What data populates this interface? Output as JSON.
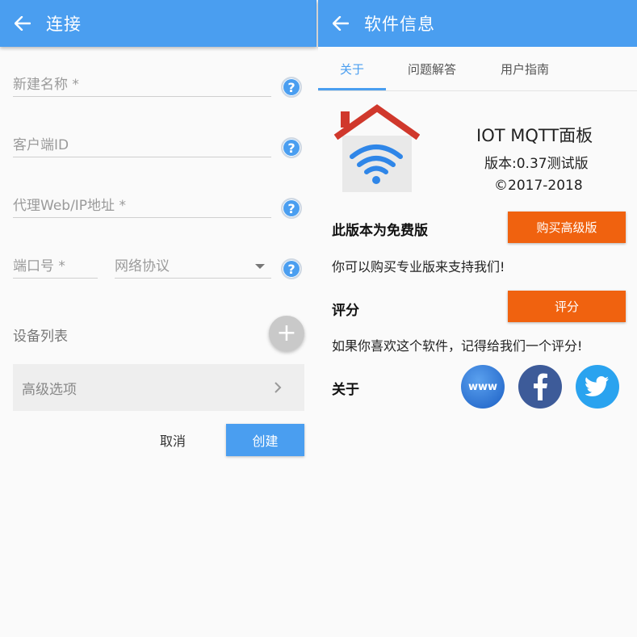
{
  "left": {
    "title": "连接",
    "fields": {
      "name": "新建名称 *",
      "client_id": "客户端ID",
      "broker": "代理Web/IP地址 *",
      "port": "端口号 *",
      "protocol": "网络协议"
    },
    "help_glyph": "?",
    "device_list": "设备列表",
    "add_glyph": "+",
    "advanced": "高级选项",
    "cancel": "取消",
    "create": "创建"
  },
  "right": {
    "title": "软件信息",
    "tabs": [
      "关于",
      "问题解答",
      "用户指南"
    ],
    "app_name": "IOT MQTT面板",
    "version": "版本:0.37测试版",
    "copyright": "©2017-2018",
    "free_title": "此版本为免费版",
    "buy_button": "购买高级版",
    "support_text": "你可以购买专业版来支持我们!",
    "rate_title": "评分",
    "rate_button": "评分",
    "rate_text": "如果你喜欢这个软件，记得给我们一个评分!",
    "about_title": "关于",
    "www_label": "www"
  },
  "colors": {
    "primary": "#4a9ef0",
    "accent": "#f0620f",
    "facebook": "#3d5b99",
    "twitter": "#2aa3ef"
  },
  "icons": [
    "back-arrow-icon",
    "help-icon",
    "add-icon",
    "chevron-right-icon",
    "dropdown-arrow-icon",
    "house-wifi-logo",
    "www-icon",
    "facebook-icon",
    "twitter-icon"
  ]
}
